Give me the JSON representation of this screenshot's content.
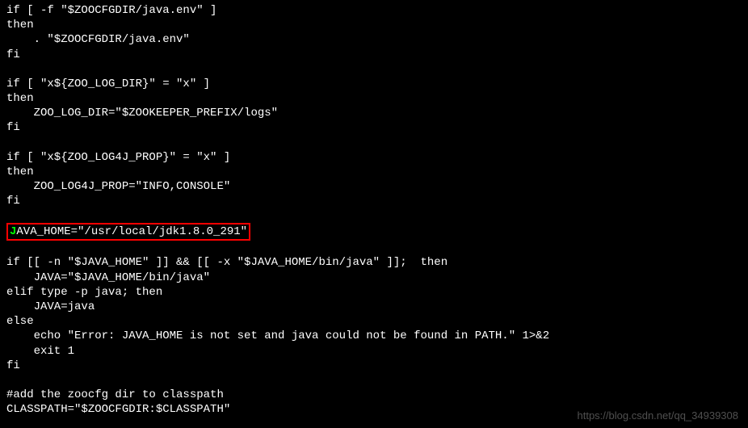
{
  "code": {
    "l1": "if [ -f \"$ZOOCFGDIR/java.env\" ]",
    "l2": "then",
    "l3": "    . \"$ZOOCFGDIR/java.env\"",
    "l4": "fi",
    "l5": "",
    "l6": "if [ \"x${ZOO_LOG_DIR}\" = \"x\" ]",
    "l7": "then",
    "l8": "    ZOO_LOG_DIR=\"$ZOOKEEPER_PREFIX/logs\"",
    "l9": "fi",
    "l10": "",
    "l11": "if [ \"x${ZOO_LOG4J_PROP}\" = \"x\" ]",
    "l12": "then",
    "l13": "    ZOO_LOG4J_PROP=\"INFO,CONSOLE\"",
    "l14": "fi",
    "l15": "",
    "highlighted_cursor": "J",
    "highlighted_rest": "AVA_HOME=\"/usr/local/jdk1.8.0_291\"",
    "l17": "",
    "l18": "if [[ -n \"$JAVA_HOME\" ]] && [[ -x \"$JAVA_HOME/bin/java\" ]];  then",
    "l19": "    JAVA=\"$JAVA_HOME/bin/java\"",
    "l20": "elif type -p java; then",
    "l21": "    JAVA=java",
    "l22": "else",
    "l23": "    echo \"Error: JAVA_HOME is not set and java could not be found in PATH.\" 1>&2",
    "l24": "    exit 1",
    "l25": "fi",
    "l26": "",
    "l27": "#add the zoocfg dir to classpath",
    "l28": "CLASSPATH=\"$ZOOCFGDIR:$CLASSPATH\""
  },
  "watermark": "https://blog.csdn.net/qq_34939308"
}
